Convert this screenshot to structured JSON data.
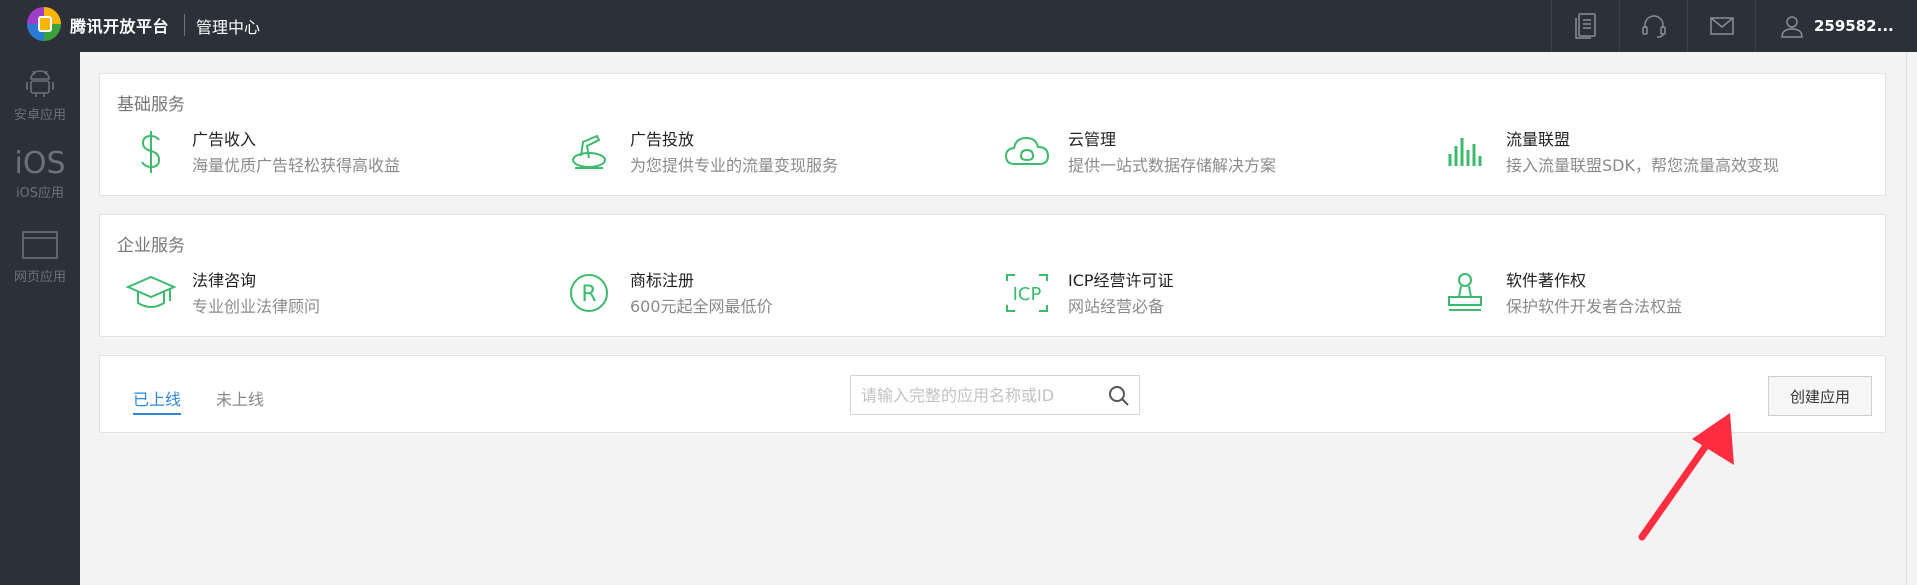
{
  "header": {
    "brand": "腾讯开放平台",
    "subtitle": "管理中心",
    "icons": [
      "document-icon",
      "headset-icon",
      "mail-icon"
    ],
    "user": "259582..."
  },
  "sidebar": {
    "items": [
      {
        "label": "安卓应用",
        "icon": "android-icon"
      },
      {
        "label": "iOS应用",
        "icon_text": "iOS"
      },
      {
        "label": "网页应用",
        "icon": "browser-icon"
      }
    ]
  },
  "basic_services": {
    "title": "基础服务",
    "items": [
      {
        "name": "广告收入",
        "desc": "海量优质广告轻松获得高收益",
        "icon": "dollar-icon"
      },
      {
        "name": "广告投放",
        "desc": "为您提供专业的流量变现服务",
        "icon": "megaphone-icon"
      },
      {
        "name": "云管理",
        "desc": "提供一站式数据存储解决方案",
        "icon": "cloud-icon"
      },
      {
        "name": "流量联盟",
        "desc": "接入流量联盟SDK，帮您流量高效变现",
        "icon": "bars-icon"
      }
    ]
  },
  "enterprise_services": {
    "title": "企业服务",
    "items": [
      {
        "name": "法律咨询",
        "desc": "专业创业法律顾问",
        "icon": "graduation-cap-icon"
      },
      {
        "name": "商标注册",
        "desc": "600元起全网最低价",
        "icon": "registered-icon",
        "icon_text": "R"
      },
      {
        "name": "ICP经营许可证",
        "desc": "网站经营必备",
        "icon": "icp-icon",
        "icon_text": "ICP"
      },
      {
        "name": "软件著作权",
        "desc": "保护软件开发者合法权益",
        "icon": "stamp-icon"
      }
    ]
  },
  "apps": {
    "tabs": [
      {
        "label": "已上线",
        "active": true
      },
      {
        "label": "未上线",
        "active": false
      }
    ],
    "search": {
      "placeholder": "请输入完整的应用名称或ID",
      "value": ""
    },
    "create_button": "创建应用"
  },
  "colors": {
    "topbar": "#2c3038",
    "accent_green": "#3dba6d",
    "tab_blue": "#2f86d6",
    "arrow_red": "#ff2d3f"
  }
}
